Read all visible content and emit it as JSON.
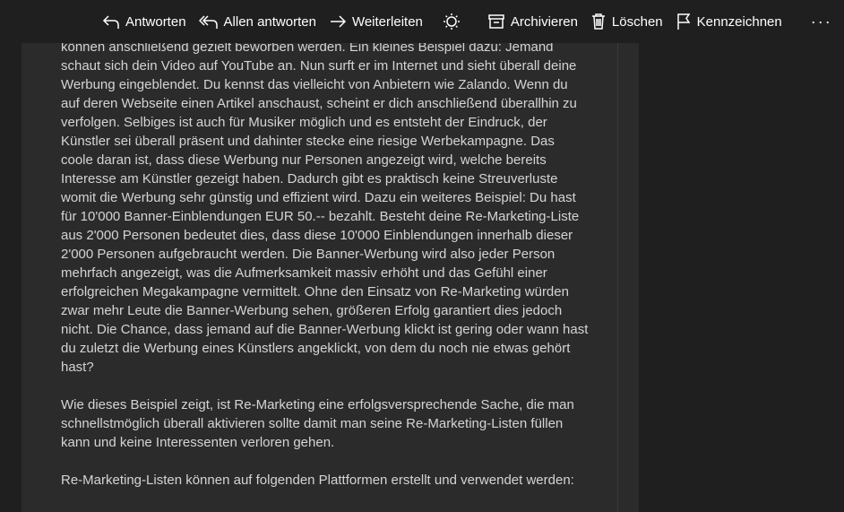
{
  "toolbar": {
    "reply_label": "Antworten",
    "reply_all_label": "Allen antworten",
    "forward_label": "Weiterleiten",
    "archive_label": "Archivieren",
    "delete_label": "Löschen",
    "flag_label": "Kennzeichnen",
    "more_label": "···",
    "icons": [
      "reply-icon",
      "reply-all-icon",
      "forward-icon",
      "brightness-icon",
      "archive-icon",
      "trash-icon",
      "flag-icon",
      "more-icon"
    ]
  },
  "email": {
    "paragraph_1": "können anschließend gezielt beworben werden. Ein kleines Beispiel dazu: Jemand schaut sich dein Video auf YouTube an. Nun surft er im Internet und sieht überall deine Werbung eingeblendet. Du kennst das vielleicht von Anbietern wie Zalando. Wenn du auf deren Webseite einen Artikel anschaust, scheint er dich anschließend überallhin zu verfolgen. Selbiges ist auch für Musiker möglich und es entsteht der Eindruck, der Künstler sei überall präsent und dahinter stecke eine riesige Werbekampagne. Das coole daran ist, dass diese Werbung nur Personen angezeigt wird, welche bereits Interesse am Künstler gezeigt haben. Dadurch gibt es praktisch keine Streuverluste womit die Werbung sehr günstig und effizient wird. Dazu ein weiteres Beispiel: Du hast für 10'000 Banner-Einblendungen EUR 50.-- bezahlt. Besteht deine Re-Marketing-Liste aus 2'000 Personen bedeutet dies, dass diese 10'000 Einblendungen innerhalb dieser 2'000 Personen aufgebraucht werden. Die Banner-Werbung wird also jeder Person mehrfach angezeigt, was die Aufmerksamkeit massiv erhöht und das Gefühl einer erfolgreichen Megakampagne vermittelt. Ohne den Einsatz von Re-Marketing würden zwar mehr Leute die Banner-Werbung sehen, größeren Erfolg garantiert dies jedoch nicht. Die Chance, dass jemand auf die Banner-Werbung klickt ist gering oder wann hast du zuletzt die Werbung eines Künstlers angeklickt, von dem du noch nie etwas gehört hast?",
    "paragraph_2": "Wie dieses Beispiel zeigt, ist Re-Marketing eine erfolgsversprechende Sache, die man schnellstmöglich überall aktivieren sollte damit man seine Re-Marketing-Listen füllen kann und keine Interessenten verloren gehen.",
    "paragraph_3": "Re-Marketing-Listen können auf folgenden Plattformen erstellt und verwendet werden:"
  }
}
